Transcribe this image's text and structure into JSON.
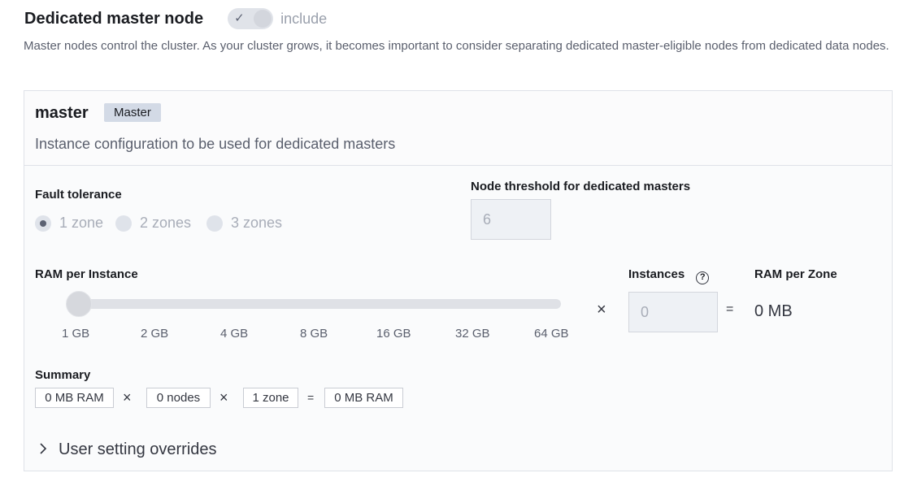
{
  "header": {
    "title": "Dedicated master node",
    "toggle_label": "include",
    "toggle_icon": "check-icon",
    "description": "Master nodes control the cluster. As your cluster grows, it becomes important to consider separating dedicated master-eligible nodes from dedicated data nodes."
  },
  "panel": {
    "title": "master",
    "badge": "Master",
    "subtitle": "Instance configuration to be used for dedicated masters"
  },
  "fault_tolerance": {
    "label": "Fault tolerance",
    "options": [
      "1 zone",
      "2 zones",
      "3 zones"
    ],
    "selected": "1 zone"
  },
  "node_threshold": {
    "label": "Node threshold for dedicated masters",
    "value": "6"
  },
  "ram_per_instance": {
    "label": "RAM per Instance",
    "ticks": [
      "1 GB",
      "2 GB",
      "4 GB",
      "8 GB",
      "16 GB",
      "32 GB",
      "64 GB"
    ],
    "selected": "1 GB"
  },
  "instances": {
    "label": "Instances",
    "value": "0",
    "help_icon": "question-circle-icon"
  },
  "ram_per_zone": {
    "label": "RAM per Zone",
    "value": "0 MB"
  },
  "operators": {
    "times": "×",
    "equals": "="
  },
  "summary": {
    "label": "Summary",
    "ram": "0 MB RAM",
    "nodes": "0 nodes",
    "zones": "1 zone",
    "total": "0 MB RAM"
  },
  "overrides": {
    "label": "User setting overrides",
    "icon": "chevron-right-icon"
  }
}
